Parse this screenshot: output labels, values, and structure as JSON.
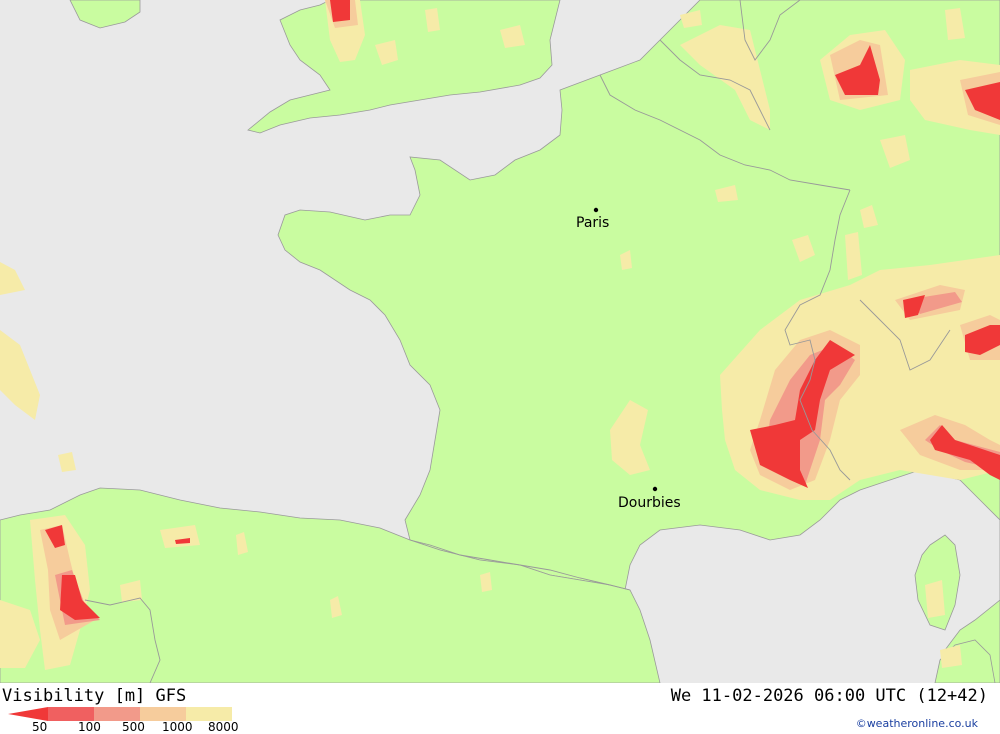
{
  "title": {
    "left": "Visibility [m] GFS",
    "right": "We 11-02-2026 06:00 UTC (12+42)"
  },
  "legend": {
    "entries": [
      {
        "label": "50",
        "color": "#f03838"
      },
      {
        "label": "100",
        "color": "#f06060"
      },
      {
        "label": "500",
        "color": "#f29a8a"
      },
      {
        "label": "1000",
        "color": "#f6cc9c"
      },
      {
        "label": "8000",
        "color": "#f6eba8"
      }
    ]
  },
  "cities": [
    {
      "name": "Paris"
    },
    {
      "name": "Dourbies"
    }
  ],
  "credit": "©weatheronline.co.uk",
  "colors": {
    "sea": "#e9e9e9",
    "land": "#c9fca0",
    "border": "#999999"
  }
}
